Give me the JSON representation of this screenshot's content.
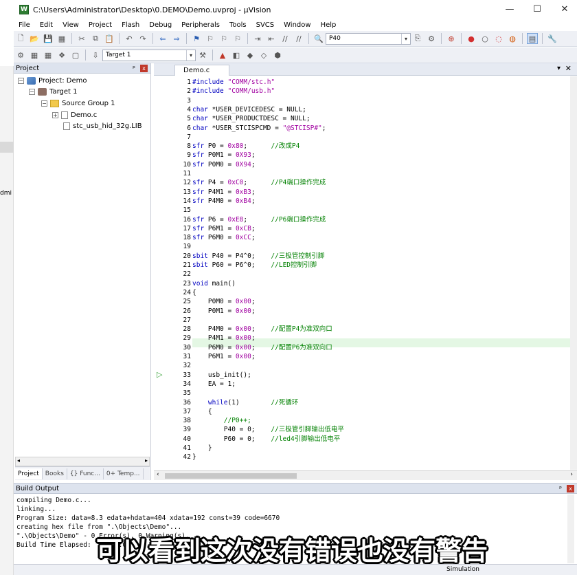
{
  "window": {
    "title": "C:\\Users\\Administrator\\Desktop\\0.DEMO\\Demo.uvproj - µVision",
    "app_icon_letter": "W",
    "controls": [
      "—",
      "☐",
      "✕"
    ]
  },
  "menu": [
    "File",
    "Edit",
    "View",
    "Project",
    "Flash",
    "Debug",
    "Peripherals",
    "Tools",
    "SVCS",
    "Window",
    "Help"
  ],
  "toolbar1": {
    "target_combo": "P40"
  },
  "toolbar2": {
    "target_select": "Target 1"
  },
  "project_panel": {
    "title": "Project",
    "pin": "ᵖ",
    "close": "x",
    "tree": [
      {
        "label": "Project: Demo",
        "expander": "−"
      },
      {
        "label": "Target 1",
        "expander": "−"
      },
      {
        "label": "Source Group 1",
        "expander": "−"
      },
      {
        "label": "Demo.c",
        "expander": "+"
      },
      {
        "label": "stc_usb_hid_32g.LIB",
        "expander": ""
      }
    ],
    "tabs": [
      "Project",
      "Books",
      "{} Func...",
      "0+ Temp..."
    ]
  },
  "left_strip_text": "dmi",
  "editor": {
    "tab": "Demo.c",
    "line_numbers": [
      "1",
      "2",
      "3",
      "4",
      "5",
      "6",
      "7",
      "8",
      "9",
      "10",
      "11",
      "12",
      "13",
      "14",
      "15",
      "16",
      "17",
      "18",
      "19",
      "20",
      "21",
      "22",
      "23",
      "24",
      "25",
      "26",
      "27",
      "28",
      "29",
      "30",
      "31",
      "32",
      "33",
      "34",
      "35",
      "36",
      "37",
      "38",
      "39",
      "40",
      "41",
      "42"
    ],
    "lines": [
      "#include \"COMM/stc.h\"",
      "#include \"COMM/usb.h\"",
      "",
      "char *USER_DEVICEDESC = NULL;",
      "char *USER_PRODUCTDESC = NULL;",
      "char *USER_STCISPCMD = \"@STCISP#\";",
      "",
      "sfr P0 = 0x80;      //改成P4",
      "sfr P0M1 = 0X93;",
      "sfr P0M0 = 0X94;",
      "",
      "sfr P4 = 0xC0;      //P4端口操作完成",
      "sfr P4M1 = 0xB3;",
      "sfr P4M0 = 0xB4;",
      "",
      "sfr P6 = 0xE8;      //P6端口操作完成",
      "sfr P6M1 = 0xCB;",
      "sfr P6M0 = 0xCC;",
      "",
      "sbit P40 = P4^0;    //三极管控制引脚",
      "sbit P60 = P6^0;    //LED控制引脚",
      "",
      "void main()",
      "{",
      "    P0M0 = 0x00;",
      "    P0M1 = 0x00;",
      "",
      "    P4M0 = 0x00;    //配置P4为准双向口",
      "    P4M1 = 0x00;",
      "    P6M0 = 0x00;    //配置P6为准双向口",
      "    P6M1 = 0x00;",
      "",
      "    usb_init();",
      "    EA = 1;",
      "",
      "    while(1)        //死循环",
      "    {",
      "        //P0++;",
      "        P40 = 0;    //三极管引脚输出低电平",
      "        P60 = 0;    //led4引脚输出低电平",
      "    }",
      "}"
    ]
  },
  "build_output": {
    "title": "Build Output",
    "lines": [
      "compiling Demo.c...",
      "linking...",
      "Program Size: data=8.3 edata+hdata=404 xdata=192 const=39 code=6670",
      "creating hex file from \".\\Objects\\Demo\"...",
      "\".\\Objects\\Demo\" - 0 Error(s), 0 Warning(s).",
      "Build Time Elapsed:  00:00:03"
    ]
  },
  "subtitle": "可以看到这次没有错误也没有警告",
  "status": {
    "mode": "Simulation"
  }
}
